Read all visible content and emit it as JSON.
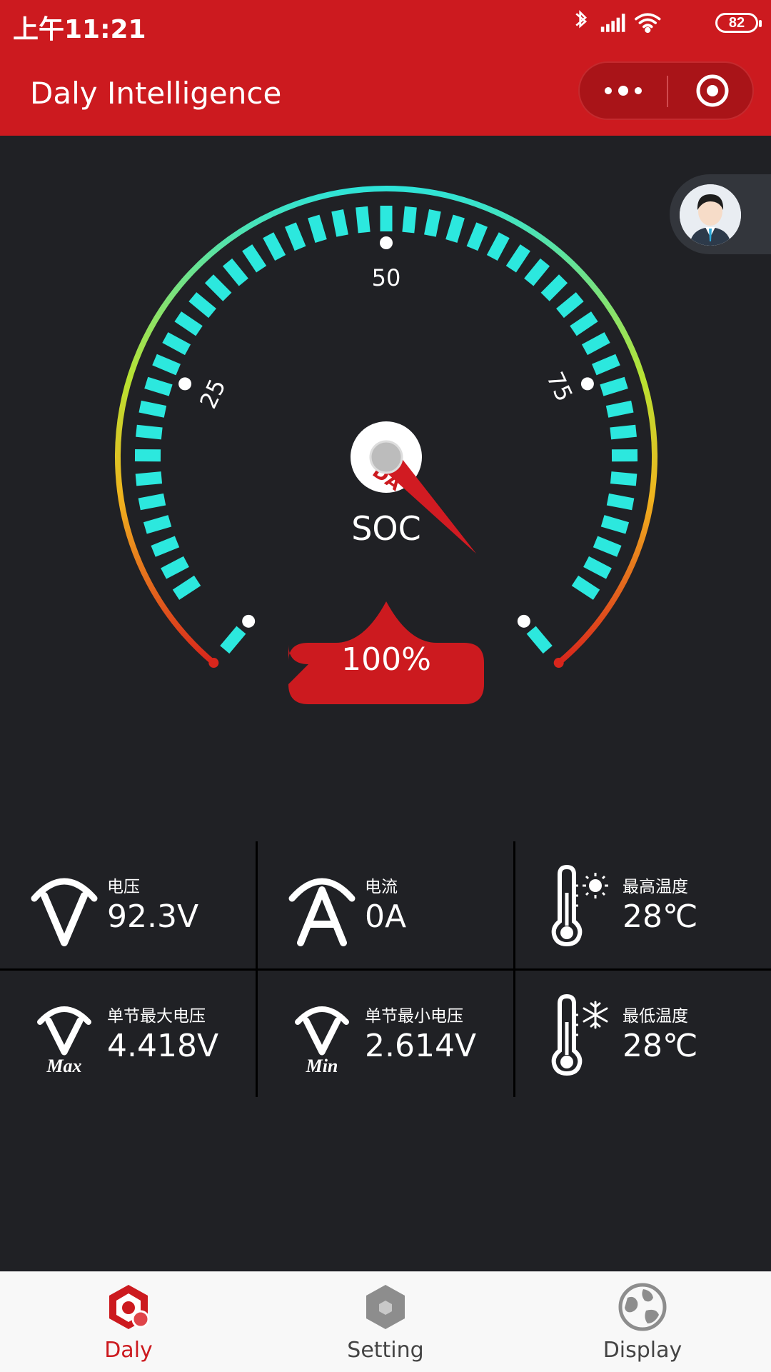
{
  "status_bar": {
    "time": "上午11:21",
    "battery": "82"
  },
  "app_bar": {
    "title": "Daly Intelligence"
  },
  "gauge": {
    "label": "SOC",
    "value_text": "100%",
    "soc_value": 100,
    "tick_labels": [
      "25",
      "50",
      "75"
    ],
    "colors": {
      "tick": "#2ce8de",
      "needle": "#d11b22",
      "badge": "#cc1a1f"
    }
  },
  "metrics": [
    {
      "label": "电压",
      "value": "92.3V",
      "icon": "voltage-icon"
    },
    {
      "label": "电流",
      "value": "0A",
      "icon": "current-icon"
    },
    {
      "label": "最高温度",
      "value": "28℃",
      "icon": "thermometer-sun-icon"
    },
    {
      "label": "单节最大电压",
      "value": "4.418V",
      "icon": "voltage-max-icon"
    },
    {
      "label": "单节最小电压",
      "value": "2.614V",
      "icon": "voltage-min-icon"
    },
    {
      "label": "最低温度",
      "value": "28℃",
      "icon": "thermometer-snow-icon"
    }
  ],
  "icon_text": {
    "max": "Max",
    "min": "Min"
  },
  "tabs": [
    {
      "label": "Daly",
      "active": true,
      "icon": "daly-logo-icon"
    },
    {
      "label": "Setting",
      "active": false,
      "icon": "hexagon-icon"
    },
    {
      "label": "Display",
      "active": false,
      "icon": "globe-icon"
    }
  ],
  "accent_color": "#cc1a1f"
}
